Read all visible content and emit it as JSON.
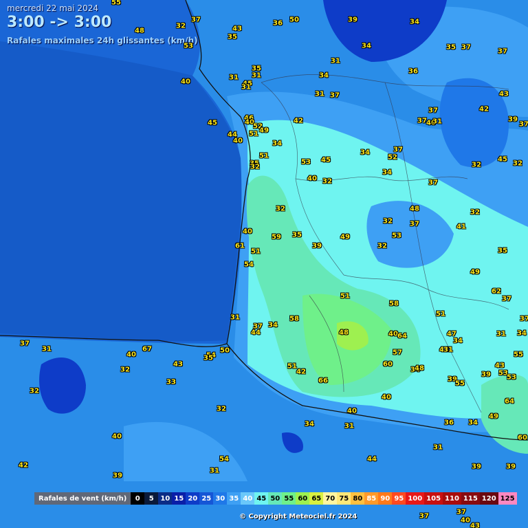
{
  "header": {
    "date": "mercredi 22 mai 2024",
    "time_range": "3:00 -> 3:00",
    "subtitle": "Rafales maximales 24h glissantes (km/h)"
  },
  "legend": {
    "title": "Rafales de vent (km/h)",
    "steps": [
      {
        "label": "0",
        "color": "#000000",
        "text": "#ffffff"
      },
      {
        "label": "5",
        "color": "#0a1a3a",
        "text": "#ffffff"
      },
      {
        "label": "10",
        "color": "#0b2c86",
        "text": "#ffffff"
      },
      {
        "label": "15",
        "color": "#0a1fa8",
        "text": "#ffffff"
      },
      {
        "label": "20",
        "color": "#0e3cc8",
        "text": "#ffffff"
      },
      {
        "label": "25",
        "color": "#1556d6",
        "text": "#ffffff"
      },
      {
        "label": "30",
        "color": "#1f78e8",
        "text": "#ffffff"
      },
      {
        "label": "35",
        "color": "#3ea0f4",
        "text": "#ffffff"
      },
      {
        "label": "40",
        "color": "#6ac8fa",
        "text": "#ffffff"
      },
      {
        "label": "45",
        "color": "#6ff4f0",
        "text": "#000000"
      },
      {
        "label": "50",
        "color": "#66e8b8",
        "text": "#000000"
      },
      {
        "label": "55",
        "color": "#6ff08a",
        "text": "#000000"
      },
      {
        "label": "60",
        "color": "#9ef050",
        "text": "#000000"
      },
      {
        "label": "65",
        "color": "#d8f040",
        "text": "#000000"
      },
      {
        "label": "70",
        "color": "#fff5a0",
        "text": "#000000"
      },
      {
        "label": "75",
        "color": "#ffe878",
        "text": "#000000"
      },
      {
        "label": "80",
        "color": "#ffc040",
        "text": "#000000"
      },
      {
        "label": "85",
        "color": "#ff9a2a",
        "text": "#ffffff"
      },
      {
        "label": "90",
        "color": "#ff7a1a",
        "text": "#ffffff"
      },
      {
        "label": "95",
        "color": "#ff4a20",
        "text": "#ffffff"
      },
      {
        "label": "100",
        "color": "#e81818",
        "text": "#ffffff"
      },
      {
        "label": "105",
        "color": "#c81010",
        "text": "#ffffff"
      },
      {
        "label": "110",
        "color": "#a80c0c",
        "text": "#ffffff"
      },
      {
        "label": "115",
        "color": "#880a10",
        "text": "#ffffff"
      },
      {
        "label": "120",
        "color": "#6a0810",
        "text": "#ffffff"
      },
      {
        "label": "125",
        "color": "#ff88c0",
        "text": "#000000"
      }
    ]
  },
  "copyright": "© Copyright Meteociel.fr 2024",
  "stations": [
    {
      "v": "55"
    },
    {
      "v": "48"
    },
    {
      "v": "32"
    },
    {
      "v": "37"
    },
    {
      "v": "43"
    },
    {
      "v": "35"
    },
    {
      "v": "36"
    },
    {
      "v": "50"
    },
    {
      "v": "39"
    },
    {
      "v": "34"
    },
    {
      "v": "34"
    },
    {
      "v": "35"
    },
    {
      "v": "37"
    },
    {
      "v": "37"
    },
    {
      "v": "53"
    },
    {
      "v": "31"
    },
    {
      "v": "35"
    },
    {
      "v": "31"
    },
    {
      "v": "34"
    },
    {
      "v": "36"
    },
    {
      "v": "40"
    },
    {
      "v": "31"
    },
    {
      "v": "45"
    },
    {
      "v": "31"
    },
    {
      "v": "31"
    },
    {
      "v": "37"
    },
    {
      "v": "43"
    },
    {
      "v": "42"
    },
    {
      "v": "37"
    },
    {
      "v": "37"
    },
    {
      "v": "40"
    },
    {
      "v": "31"
    },
    {
      "v": "39"
    },
    {
      "v": "37"
    },
    {
      "v": "45"
    },
    {
      "v": "46"
    },
    {
      "v": "40"
    },
    {
      "v": "42"
    },
    {
      "v": "52"
    },
    {
      "v": "44"
    },
    {
      "v": "51"
    },
    {
      "v": "49"
    },
    {
      "v": "40"
    },
    {
      "v": "34"
    },
    {
      "v": "34"
    },
    {
      "v": "37"
    },
    {
      "v": "52"
    },
    {
      "v": "32"
    },
    {
      "v": "45"
    },
    {
      "v": "32"
    },
    {
      "v": "51"
    },
    {
      "v": "53"
    },
    {
      "v": "45"
    },
    {
      "v": "35"
    },
    {
      "v": "32"
    },
    {
      "v": "34"
    },
    {
      "v": "40"
    },
    {
      "v": "32"
    },
    {
      "v": "37"
    },
    {
      "v": "32"
    },
    {
      "v": "48"
    },
    {
      "v": "32"
    },
    {
      "v": "37"
    },
    {
      "v": "41"
    },
    {
      "v": "40"
    },
    {
      "v": "59"
    },
    {
      "v": "35"
    },
    {
      "v": "53"
    },
    {
      "v": "61"
    },
    {
      "v": "51"
    },
    {
      "v": "39"
    },
    {
      "v": "49"
    },
    {
      "v": "32"
    },
    {
      "v": "32"
    },
    {
      "v": "35"
    },
    {
      "v": "54"
    },
    {
      "v": "49"
    },
    {
      "v": "51"
    },
    {
      "v": "58"
    },
    {
      "v": "62"
    },
    {
      "v": "37"
    },
    {
      "v": "31"
    },
    {
      "v": "37"
    },
    {
      "v": "34"
    },
    {
      "v": "58"
    },
    {
      "v": "51"
    },
    {
      "v": "44"
    },
    {
      "v": "48"
    },
    {
      "v": "40"
    },
    {
      "v": "64"
    },
    {
      "v": "47"
    },
    {
      "v": "34"
    },
    {
      "v": "31"
    },
    {
      "v": "34"
    },
    {
      "v": "37"
    },
    {
      "v": "37"
    },
    {
      "v": "31"
    },
    {
      "v": "40"
    },
    {
      "v": "67"
    },
    {
      "v": "43"
    },
    {
      "v": "54"
    },
    {
      "v": "50"
    },
    {
      "v": "35"
    },
    {
      "v": "57"
    },
    {
      "v": "43"
    },
    {
      "v": "31"
    },
    {
      "v": "55"
    },
    {
      "v": "43"
    },
    {
      "v": "32"
    },
    {
      "v": "51"
    },
    {
      "v": "42"
    },
    {
      "v": "60"
    },
    {
      "v": "34"
    },
    {
      "v": "48"
    },
    {
      "v": "39"
    },
    {
      "v": "53"
    },
    {
      "v": "33"
    },
    {
      "v": "66"
    },
    {
      "v": "39"
    },
    {
      "v": "55"
    },
    {
      "v": "53"
    },
    {
      "v": "32"
    },
    {
      "v": "40"
    },
    {
      "v": "64"
    },
    {
      "v": "32"
    },
    {
      "v": "40"
    },
    {
      "v": "49"
    },
    {
      "v": "34"
    },
    {
      "v": "31"
    },
    {
      "v": "36"
    },
    {
      "v": "34"
    },
    {
      "v": "40"
    },
    {
      "v": "60"
    },
    {
      "v": "31"
    },
    {
      "v": "44"
    },
    {
      "v": "54"
    },
    {
      "v": "42"
    },
    {
      "v": "39"
    },
    {
      "v": "31"
    },
    {
      "v": "39"
    },
    {
      "v": "39"
    },
    {
      "v": "37"
    },
    {
      "v": "40"
    },
    {
      "v": "43"
    },
    {
      "v": "37"
    }
  ]
}
